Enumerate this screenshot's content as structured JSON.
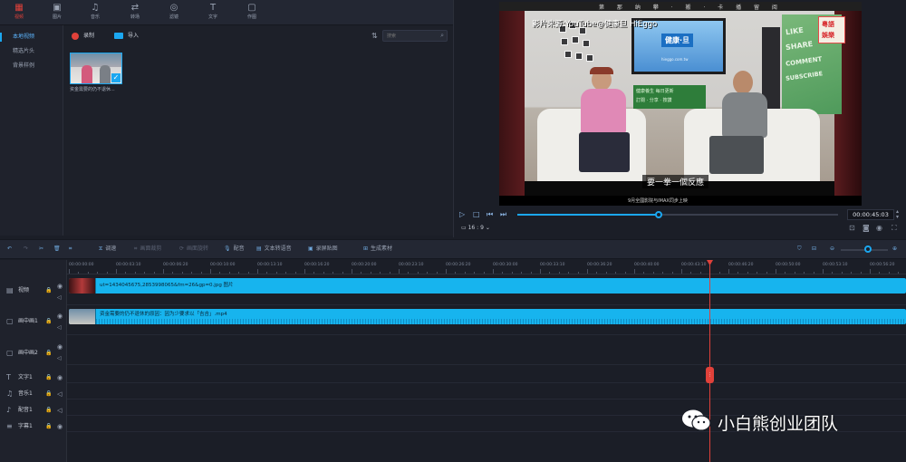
{
  "toolbar": {
    "items": [
      {
        "label": "视频",
        "icon": "film-icon"
      },
      {
        "label": "图片",
        "icon": "image-icon"
      },
      {
        "label": "音乐",
        "icon": "music-icon"
      },
      {
        "label": "转场",
        "icon": "transition-icon"
      },
      {
        "label": "滤镜",
        "icon": "filter-icon"
      },
      {
        "label": "文字",
        "icon": "text-icon"
      },
      {
        "label": "作图",
        "icon": "draw-icon"
      }
    ]
  },
  "leftnav": {
    "items": [
      "本地视频",
      "精选片头",
      "背景样例"
    ]
  },
  "media": {
    "record_label": "录制",
    "import_label": "导入",
    "search_placeholder": "搜索",
    "thumb_name": "资金需要的仍不退休..."
  },
  "preview": {
    "video": {
      "top_text": "第 那 纳 攀 · 搬 · 卡 播 留 阅",
      "source_text": "影片来源:YouTube@健康旦 HiEggo",
      "tv_logo": "健康·旦",
      "tv_url": "hieggo.com.tw",
      "board_line1": "健康養生  每日更新",
      "board_line2": "訂閱 · 分享 · 按讚",
      "subtitle": "要一拳一個反應",
      "bottom_text": "9月全國影院与IMAX同步上映",
      "green_words": [
        "LIKE",
        "SHARE",
        "COMMENT",
        "SUBSCRIBE"
      ],
      "badge_words": [
        "粵語",
        "娛樂"
      ]
    },
    "progress": 0.44,
    "timecode": "00:00:45:03",
    "ratio": "16 : 9"
  },
  "timeline_toolbar": {
    "items": [
      {
        "label": "调速",
        "icon": "speed-icon",
        "enabled": true
      },
      {
        "label": "画面裁剪",
        "icon": "crop-icon",
        "enabled": false
      },
      {
        "label": "画面旋转",
        "icon": "rotate-icon",
        "enabled": false
      },
      {
        "label": "配音",
        "icon": "mic-icon",
        "enabled": true
      },
      {
        "label": "文本转语音",
        "icon": "tts-icon",
        "enabled": true
      },
      {
        "label": "录屏贴图",
        "icon": "screen-icon",
        "enabled": true
      },
      {
        "label": "生成素材",
        "icon": "generate-icon",
        "enabled": true
      }
    ]
  },
  "ruler": {
    "ticks": [
      "00:00:00:00",
      "00:00:03:10",
      "00:00:06:20",
      "00:00:10:00",
      "00:00:13:10",
      "00:00:16:20",
      "00:00:20:00",
      "00:00:23:10",
      "00:00:26:20",
      "00:00:30:00",
      "00:00:33:10",
      "00:00:36:20",
      "00:00:40:00",
      "00:00:43:10",
      "00:00:46:20",
      "00:00:50:00",
      "00:00:53:10",
      "00:00:56:20"
    ]
  },
  "tracks": [
    {
      "name": "视频",
      "icon": "film-icon"
    },
    {
      "name": "画中画1",
      "icon": "pip-icon"
    },
    {
      "name": "画中画2",
      "icon": "pip-icon"
    },
    {
      "name": "文字1",
      "icon": "text-icon"
    },
    {
      "name": "音乐1",
      "icon": "music-icon"
    },
    {
      "name": "配音1",
      "icon": "mic-icon"
    },
    {
      "name": "字幕1",
      "icon": "caption-icon"
    }
  ],
  "clips": {
    "video_clip": "ut=1434045675,2853998065&fm=26&gp=0.jpg 图片",
    "pip_clip": "资金需要的仍不退休的原因：因为少要求以「吉吉」.mp4"
  },
  "watermark": {
    "text": "小白熊创业团队"
  },
  "colors": {
    "accent": "#1ba7f0",
    "playhead": "#e0413a",
    "clip": "#17b4ee"
  }
}
